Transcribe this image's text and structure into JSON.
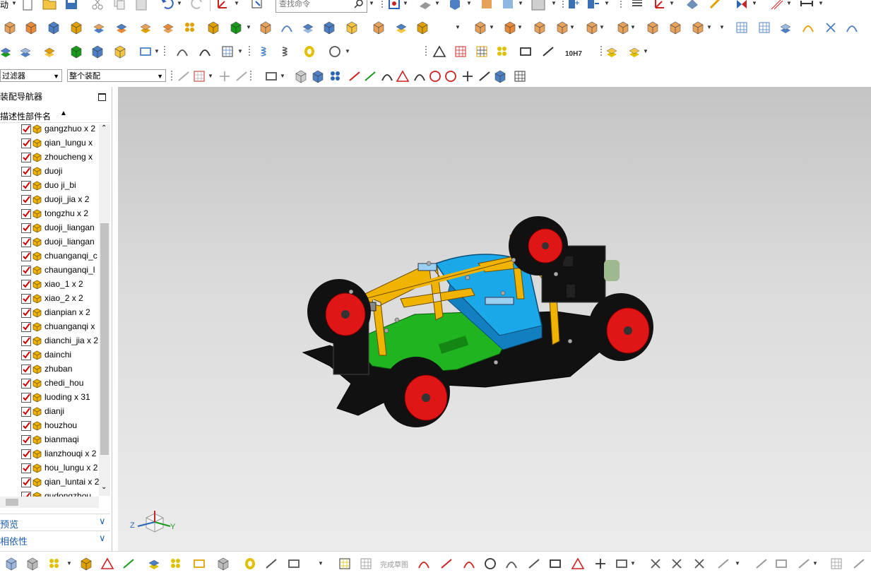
{
  "toolbar": {
    "menu_fragment": "动",
    "search_placeholder": "查找命令",
    "fit_label": "10H7"
  },
  "selection": {
    "filter_label": "类型过滤器",
    "filter_visible": "过滤器",
    "scope_label": "整个装配"
  },
  "navigator": {
    "title": "装配导航器",
    "title_visible": "装配导航器",
    "column_header": "描述性部件名",
    "column_header_visible": "描述性部件名",
    "items": [
      {
        "label": "gangzhuo x 2",
        "checked": true
      },
      {
        "label": "qian_lungu x",
        "checked": true
      },
      {
        "label": "zhoucheng x",
        "checked": true
      },
      {
        "label": "duoji",
        "checked": true
      },
      {
        "label": "duo ji_bi",
        "checked": true
      },
      {
        "label": "duoji_jia x 2",
        "checked": true
      },
      {
        "label": "tongzhu x 2",
        "checked": true
      },
      {
        "label": "duoji_liangan",
        "checked": true
      },
      {
        "label": "duoji_liangan",
        "checked": true
      },
      {
        "label": "chuanganqi_c",
        "checked": true
      },
      {
        "label": "chaunganqi_l",
        "checked": true
      },
      {
        "label": "xiao_1 x 2",
        "checked": true
      },
      {
        "label": "xiao_2 x 2",
        "checked": true
      },
      {
        "label": "dianpian x 2",
        "checked": true
      },
      {
        "label": "chuanganqi x",
        "checked": true
      },
      {
        "label": "dianchi_jia x 2",
        "checked": true
      },
      {
        "label": "dainchi",
        "checked": true
      },
      {
        "label": "zhuban",
        "checked": true
      },
      {
        "label": "chedi_hou",
        "checked": true
      },
      {
        "label": "luoding x 31",
        "checked": true
      },
      {
        "label": "dianji",
        "checked": true
      },
      {
        "label": "houzhou",
        "checked": true
      },
      {
        "label": "bianmaqi",
        "checked": true
      },
      {
        "label": "lianzhouqi x 2",
        "checked": true
      },
      {
        "label": "hou_lungu x 2",
        "checked": true
      },
      {
        "label": "qian_luntai x 2",
        "checked": true
      },
      {
        "label": "qudongzhou",
        "checked": true
      }
    ]
  },
  "panels": {
    "preview_label": "预览",
    "dependency_label": "相依性"
  },
  "sketch": {
    "finish_label": "完成草图"
  },
  "triad": {
    "z": "Z",
    "y": "Y"
  },
  "colors": {
    "accent_blue": "#1c5ba8",
    "check_red": "#cc0000",
    "part_yellow": "#f0b400"
  }
}
